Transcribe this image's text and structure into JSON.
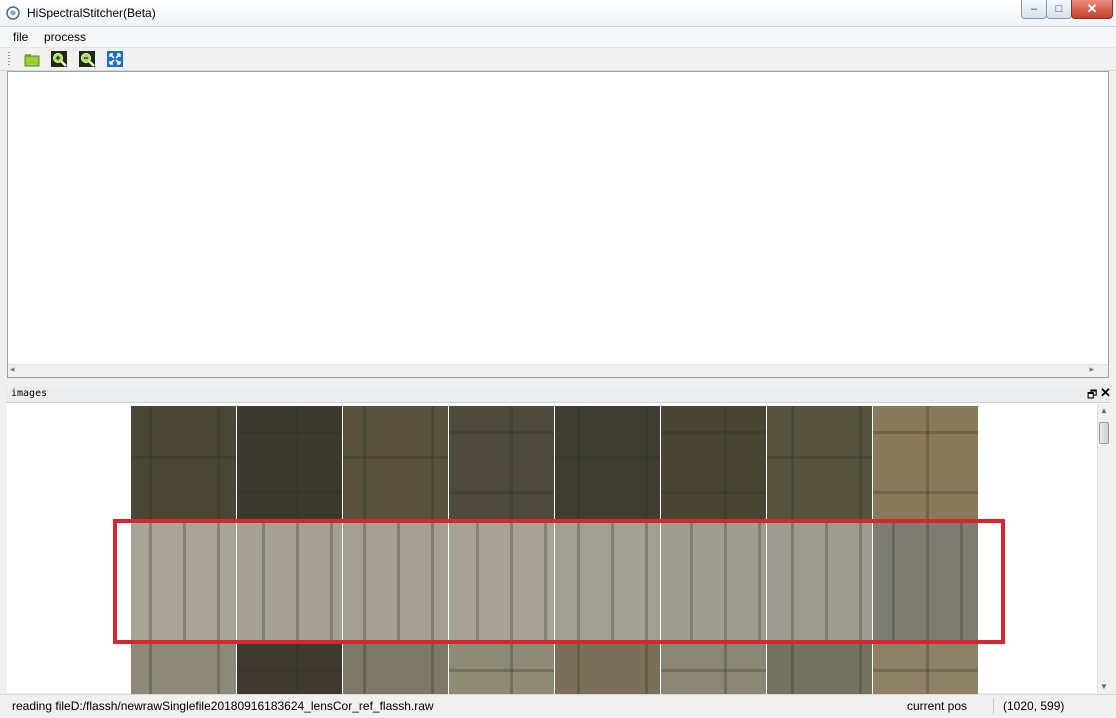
{
  "window": {
    "title": "HiSpectralStitcher(Beta)",
    "min_glyph": "–",
    "max_glyph": "□",
    "close_glyph": "✕"
  },
  "menu": {
    "items": [
      "file",
      "process"
    ]
  },
  "toolbar": {
    "tools": [
      {
        "name": "open-folder-icon"
      },
      {
        "name": "zoom-in-icon"
      },
      {
        "name": "zoom-out-icon"
      },
      {
        "name": "fit-view-icon"
      }
    ]
  },
  "dock": {
    "title": "images",
    "float_glyph": "🗗",
    "close_glyph": "✕"
  },
  "image_grid": {
    "rows": [
      {
        "row": 1,
        "kind": "dark-farmland",
        "colors": [
          "#4a4636",
          "#3c3a2e",
          "#58523e",
          "#4d4a3b",
          "#3f3d33",
          "#4a4434",
          "#56533f",
          "#8a7a5c"
        ]
      },
      {
        "row": 2,
        "kind": "bright-fields",
        "colors": [
          "#a9a496",
          "#a4a092",
          "#a3a092",
          "#a6a394",
          "#a2a092",
          "#9f9d90",
          "#9e9c90",
          "#7e7d74"
        ]
      },
      {
        "row": 3,
        "kind": "mixed",
        "colors": [
          "#8d8878",
          "#3e3a30",
          "#7d7868",
          "#8f8a76",
          "#7a6f58",
          "#8b8777",
          "#747260",
          "#8d8268"
        ]
      }
    ],
    "highlighted_row": 2
  },
  "status": {
    "message": "reading fileD:/flassh/newrawSinglefile20180916183624_lensCor_ref_flassh.raw",
    "pos_label": "current pos",
    "pos_value": "(1020, 599)"
  },
  "colors": {
    "highlight": "#d9262e",
    "titlebar": "#eef3fb"
  }
}
